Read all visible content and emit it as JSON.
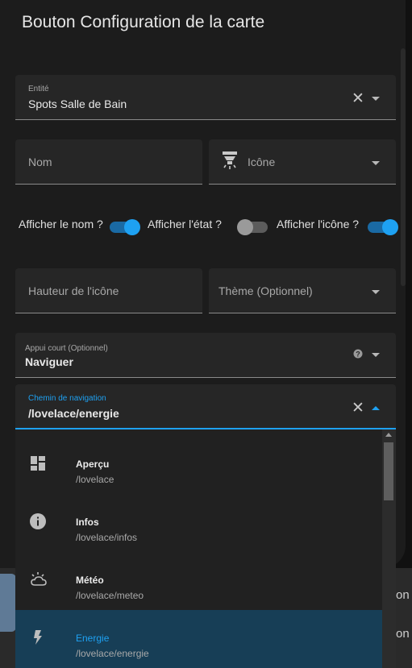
{
  "dialog": {
    "title": "Bouton Configuration de la carte"
  },
  "entity": {
    "label": "Entité",
    "value": "Spots Salle de Bain"
  },
  "name": {
    "placeholder": "Nom"
  },
  "icon": {
    "placeholder": "Icône"
  },
  "toggles": {
    "show_name": {
      "label": "Afficher le nom ?",
      "on": true
    },
    "show_state": {
      "label": "Afficher l'état ?",
      "on": false
    },
    "show_icon": {
      "label": "Afficher l'icône ?",
      "on": true
    }
  },
  "icon_height": {
    "placeholder": "Hauteur de l'icône"
  },
  "theme": {
    "placeholder": "Thème (Optionnel)"
  },
  "tap_action": {
    "label": "Appui court (Optionnel)",
    "value": "Naviguer"
  },
  "nav_path": {
    "label": "Chemin de navigation",
    "value": "/lovelace/energie"
  },
  "dropdown": {
    "items": [
      {
        "title": "Aperçu",
        "path": "/lovelace",
        "icon": "dashboard-icon",
        "selected": false
      },
      {
        "title": "Infos",
        "path": "/lovelace/infos",
        "icon": "info-icon",
        "selected": false
      },
      {
        "title": "Météo",
        "path": "/lovelace/meteo",
        "icon": "weather-partly-cloudy-icon",
        "selected": false
      },
      {
        "title": "Energie",
        "path": "/lovelace/energie",
        "icon": "flash-icon",
        "selected": true
      }
    ]
  },
  "background": {
    "text_1": "on",
    "text_2": "on"
  },
  "colors": {
    "accent": "#1ea1f2",
    "selected_bg": "#173e56",
    "dialog_bg": "#1c1c1c",
    "field_bg": "#262626"
  }
}
